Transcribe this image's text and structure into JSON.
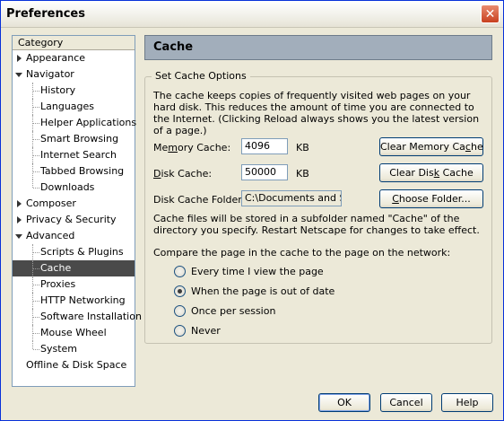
{
  "window": {
    "title": "Preferences",
    "close_glyph": "✕"
  },
  "category": {
    "header": "Category",
    "items": [
      {
        "label": "Appearance",
        "level": 0,
        "twisty": "closed"
      },
      {
        "label": "Navigator",
        "level": 0,
        "twisty": "open"
      },
      {
        "label": "History",
        "level": 1
      },
      {
        "label": "Languages",
        "level": 1
      },
      {
        "label": "Helper Applications",
        "level": 1
      },
      {
        "label": "Smart Browsing",
        "level": 1
      },
      {
        "label": "Internet Search",
        "level": 1
      },
      {
        "label": "Tabbed Browsing",
        "level": 1
      },
      {
        "label": "Downloads",
        "level": 1
      },
      {
        "label": "Composer",
        "level": 0,
        "twisty": "closed"
      },
      {
        "label": "Privacy & Security",
        "level": 0,
        "twisty": "closed"
      },
      {
        "label": "Advanced",
        "level": 0,
        "twisty": "open"
      },
      {
        "label": "Scripts & Plugins",
        "level": 1
      },
      {
        "label": "Cache",
        "level": 1,
        "selected": true
      },
      {
        "label": "Proxies",
        "level": 1
      },
      {
        "label": "HTTP Networking",
        "level": 1
      },
      {
        "label": "Software Installation",
        "level": 1
      },
      {
        "label": "Mouse Wheel",
        "level": 1
      },
      {
        "label": "System",
        "level": 1
      },
      {
        "label": "Offline & Disk Space",
        "level": 0
      }
    ]
  },
  "panel": {
    "title": "Cache",
    "group_label": "Set Cache Options",
    "description": "The cache keeps copies of frequently visited web pages on your hard disk. This reduces the amount of time you are connected to the Internet. (Clicking Reload always shows you the latest version of a page.)",
    "memory_cache": {
      "label_pre": "Me",
      "label_key": "m",
      "label_post": "ory Cache:",
      "value": "4096",
      "unit": "KB"
    },
    "disk_cache": {
      "label_pre": "",
      "label_key": "D",
      "label_post": "isk Cache:",
      "value": "50000",
      "unit": "KB"
    },
    "clear_memory_button": {
      "pre": "Clear Memory Ca",
      "key": "c",
      "post": "he"
    },
    "clear_disk_button": {
      "pre": "Clear Dis",
      "key": "k",
      "post": " Cache"
    },
    "folder": {
      "label": "Disk Cache Folder:",
      "value": "C:\\Documents and Set"
    },
    "choose_folder_button": {
      "pre": "",
      "key": "C",
      "post": "hoose Folder..."
    },
    "folder_note": "Cache files will be stored in a subfolder named \"Cache\" of the directory you specify. Restart Netscape for changes to take effect.",
    "compare_label": "Compare the page in the cache to the page on the network:",
    "compare_options": [
      {
        "label": "Every time I view the page",
        "checked": false
      },
      {
        "label": "When the page is out of date",
        "checked": true
      },
      {
        "label": "Once per session",
        "checked": false
      },
      {
        "label": "Never",
        "checked": false
      }
    ]
  },
  "footer": {
    "ok": "OK",
    "cancel": "Cancel",
    "help": "Help"
  }
}
